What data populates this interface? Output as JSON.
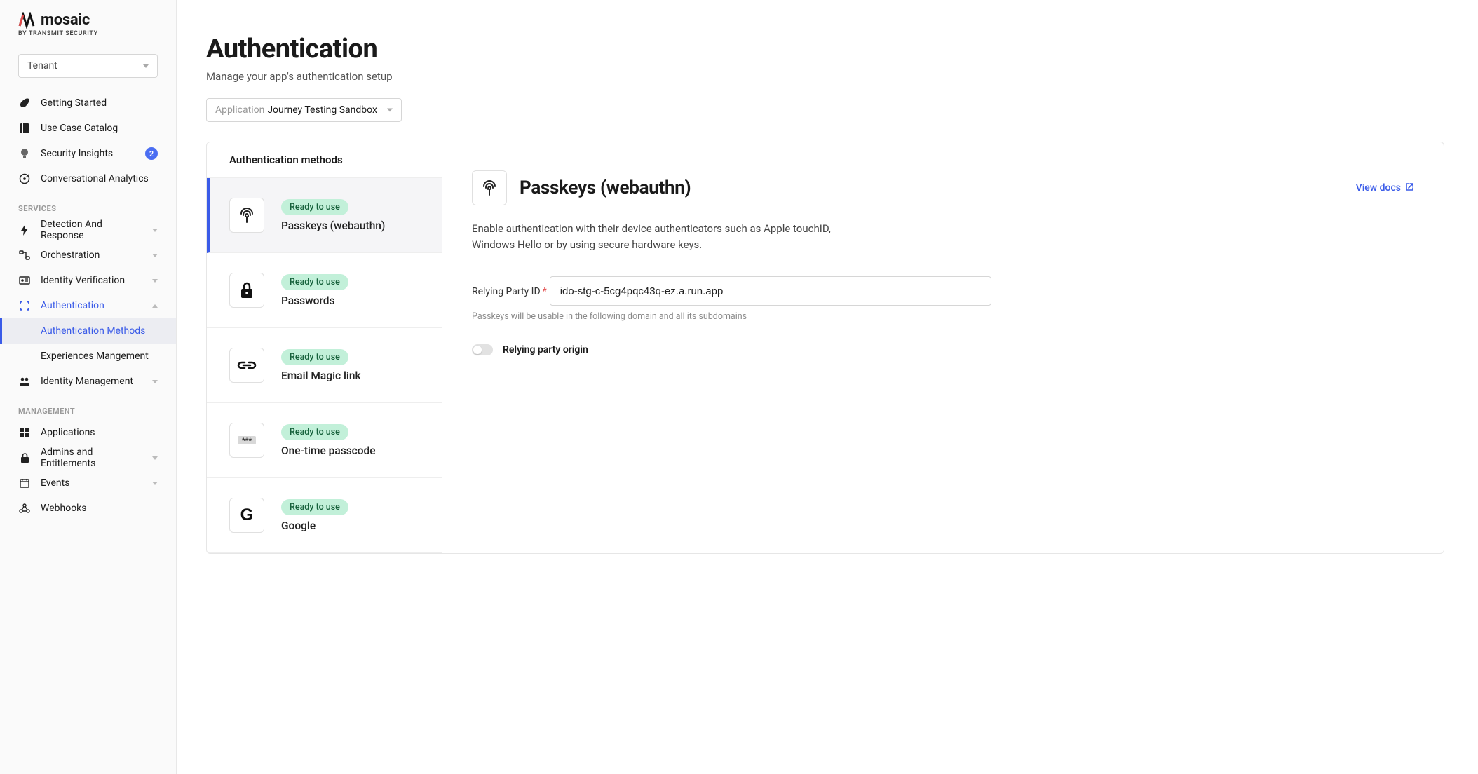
{
  "brand": {
    "name": "mosaic",
    "tagline": "BY TRANSMIT SECURITY"
  },
  "tenant_select": {
    "label": "Tenant"
  },
  "nav_top": {
    "getting_started": "Getting Started",
    "use_case_catalog": "Use Case Catalog",
    "security_insights": "Security Insights",
    "security_insights_badge": "2",
    "conversational_analytics": "Conversational Analytics"
  },
  "sections": {
    "services": "SERVICES",
    "management": "MANAGEMENT"
  },
  "nav_services": {
    "detection": "Detection And Response",
    "orchestration": "Orchestration",
    "identity_verification": "Identity Verification",
    "authentication": "Authentication",
    "auth_methods": "Authentication Methods",
    "experiences": "Experiences Mangement",
    "identity_management": "Identity Management"
  },
  "nav_management": {
    "applications": "Applications",
    "admins": "Admins and Entitlements",
    "events": "Events",
    "webhooks": "Webhooks"
  },
  "page": {
    "title": "Authentication",
    "subtitle": "Manage your app's authentication setup"
  },
  "app_select": {
    "prefix": "Application",
    "value": "Journey Testing Sandbox"
  },
  "methods": {
    "header": "Authentication methods",
    "items": [
      {
        "status": "Ready to use",
        "name": "Passkeys (webauthn)"
      },
      {
        "status": "Ready to use",
        "name": "Passwords"
      },
      {
        "status": "Ready to use",
        "name": "Email Magic link"
      },
      {
        "status": "Ready to use",
        "name": "One-time passcode"
      },
      {
        "status": "Ready to use",
        "name": "Google"
      }
    ]
  },
  "detail": {
    "title": "Passkeys (webauthn)",
    "view_docs": "View docs",
    "description": "Enable authentication with their device authenticators such as Apple touchID, Windows Hello or by using secure hardware keys.",
    "rp_label": "Relying Party ID",
    "rp_value": "ido-stg-c-5cg4pqc43q-ez.a.run.app",
    "rp_hint": "Passkeys will be usable in the following domain and all its subdomains",
    "origin_toggle_label": "Relying party origin"
  }
}
